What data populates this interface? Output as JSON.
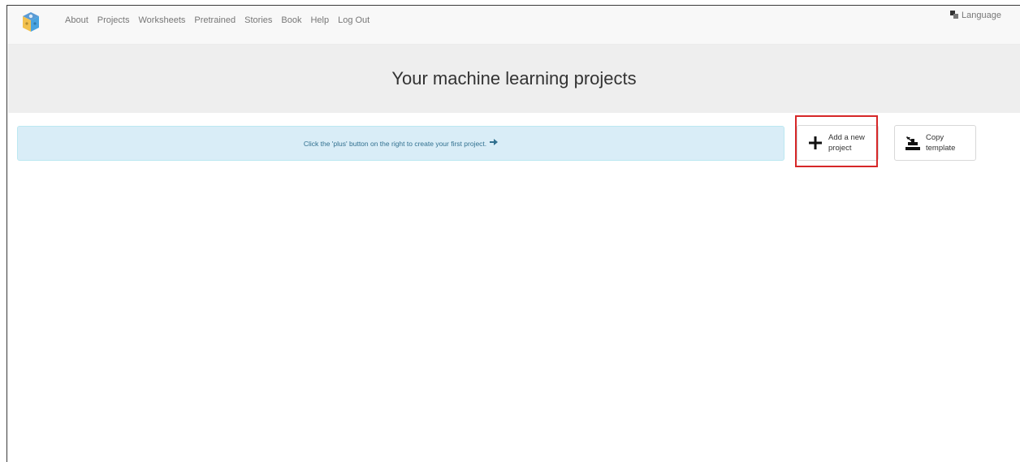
{
  "nav": {
    "items": [
      {
        "label": "About"
      },
      {
        "label": "Projects"
      },
      {
        "label": "Worksheets"
      },
      {
        "label": "Pretrained"
      },
      {
        "label": "Stories"
      },
      {
        "label": "Book"
      },
      {
        "label": "Help"
      },
      {
        "label": "Log Out"
      }
    ],
    "language_label": "Language"
  },
  "header": {
    "title": "Your machine learning projects"
  },
  "alert": {
    "message": "Click the 'plus' button on the right to create your first project."
  },
  "actions": {
    "add_label": "Add a new project",
    "copy_label": "Copy template"
  },
  "colors": {
    "navbar_bg": "#f8f8f8",
    "jumbotron_bg": "#eeeeee",
    "alert_bg": "#d9edf7",
    "alert_text": "#31708f",
    "highlight": "#d62728"
  }
}
